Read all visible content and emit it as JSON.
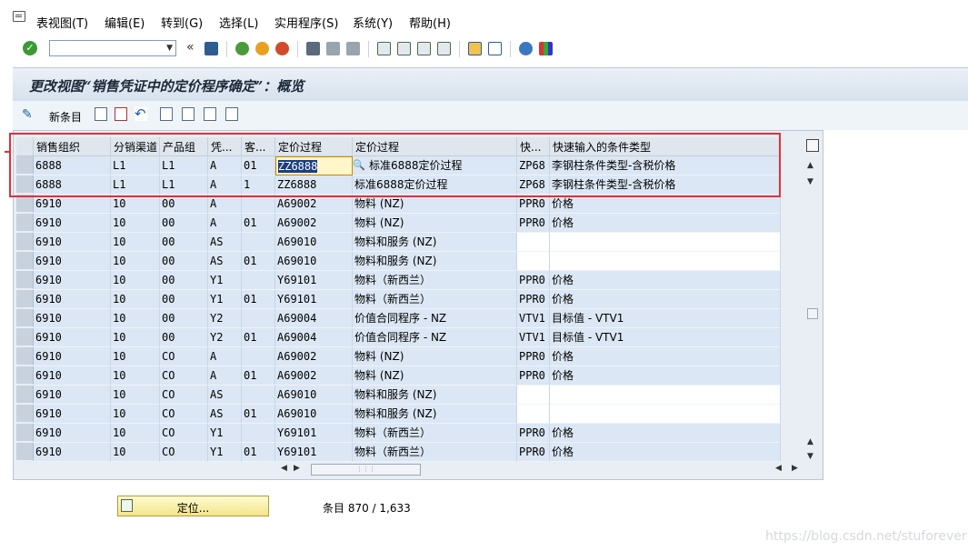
{
  "menu": [
    "表视图(T)",
    "编辑(E)",
    "转到(G)",
    "选择(L)",
    "实用程序(S)",
    "系统(Y)",
    "帮助(H)"
  ],
  "toolbar": {
    "command_field": "",
    "icons": [
      "enter-icon",
      "save-icon",
      "back-icon",
      "exit-icon",
      "cancel-icon",
      "print-icon",
      "find-icon",
      "find-next-icon",
      "first-page-icon",
      "prev-page-icon",
      "next-page-icon",
      "last-page-icon",
      "new-session-icon",
      "shortcut-icon",
      "help-icon",
      "customize-icon"
    ]
  },
  "title": "更改视图“销售凭证中的定价程序确定”：概览",
  "app_toolbar": {
    "new_entries_label": "新条目",
    "icons": [
      "details-icon",
      "copy-as-icon",
      "delete-icon",
      "undo-icon",
      "select-all-icon",
      "select-block-icon",
      "deselect-all-icon",
      "print-field-help-icon"
    ]
  },
  "table": {
    "headers": [
      "销售组织",
      "分销渠道",
      "产品组",
      "凭...",
      "客...",
      "定价过程",
      "定价过程",
      "快...",
      "快速输入的条件类型"
    ],
    "rows": [
      [
        "6888",
        "L1",
        "L1",
        "A",
        "01",
        "ZZ6888",
        "标准6888定价过程",
        "ZP68",
        "李钢柱条件类型-含税价格"
      ],
      [
        "6888",
        "L1",
        "L1",
        "A",
        "1",
        "ZZ6888",
        "标准6888定价过程",
        "ZP68",
        "李钢柱条件类型-含税价格"
      ],
      [
        "6910",
        "10",
        "00",
        "A",
        "",
        "A69002",
        "物料 (NZ)",
        "PPR0",
        "价格"
      ],
      [
        "6910",
        "10",
        "00",
        "A",
        "01",
        "A69002",
        "物料 (NZ)",
        "PPR0",
        "价格"
      ],
      [
        "6910",
        "10",
        "00",
        "AS",
        "",
        "A69010",
        "物料和服务 (NZ)",
        "",
        ""
      ],
      [
        "6910",
        "10",
        "00",
        "AS",
        "01",
        "A69010",
        "物料和服务 (NZ)",
        "",
        ""
      ],
      [
        "6910",
        "10",
        "00",
        "Y1",
        "",
        "Y69101",
        "物料（新西兰）",
        "PPR0",
        "价格"
      ],
      [
        "6910",
        "10",
        "00",
        "Y1",
        "01",
        "Y69101",
        "物料（新西兰）",
        "PPR0",
        "价格"
      ],
      [
        "6910",
        "10",
        "00",
        "Y2",
        "",
        "A69004",
        "价值合同程序 - NZ",
        "VTV1",
        "目标值 - VTV1"
      ],
      [
        "6910",
        "10",
        "00",
        "Y2",
        "01",
        "A69004",
        "价值合同程序 - NZ",
        "VTV1",
        "目标值 - VTV1"
      ],
      [
        "6910",
        "10",
        "CO",
        "A",
        "",
        "A69002",
        "物料 (NZ)",
        "PPR0",
        "价格"
      ],
      [
        "6910",
        "10",
        "CO",
        "A",
        "01",
        "A69002",
        "物料 (NZ)",
        "PPR0",
        "价格"
      ],
      [
        "6910",
        "10",
        "CO",
        "AS",
        "",
        "A69010",
        "物料和服务 (NZ)",
        "",
        ""
      ],
      [
        "6910",
        "10",
        "CO",
        "AS",
        "01",
        "A69010",
        "物料和服务 (NZ)",
        "",
        ""
      ],
      [
        "6910",
        "10",
        "CO",
        "Y1",
        "",
        "Y69101",
        "物料（新西兰）",
        "PPR0",
        "价格"
      ],
      [
        "6910",
        "10",
        "CO",
        "Y1",
        "01",
        "Y69101",
        "物料（新西兰）",
        "PPR0",
        "价格"
      ]
    ]
  },
  "footer": {
    "locate_button": "定位...",
    "entries_text": "条目 870 / 1,633"
  },
  "watermark": "https://blog.csdn.net/stuforever",
  "colors": {
    "highlight_box": "#e0303a",
    "cell_bg": "#dbe7f4",
    "edit_bg": "#fff7c9",
    "title_text": "#1b2838"
  }
}
